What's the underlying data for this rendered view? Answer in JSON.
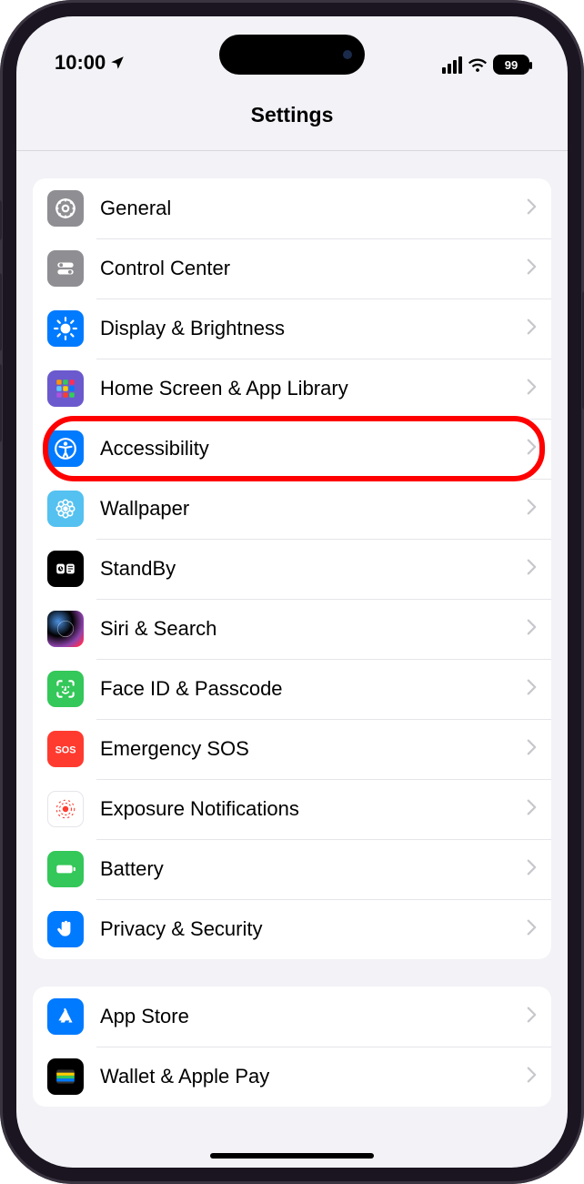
{
  "status": {
    "time": "10:00",
    "battery": "99"
  },
  "nav": {
    "title": "Settings"
  },
  "annotation": {
    "highlightedKey": "accessibility",
    "highlightColor": "#ff0000"
  },
  "groups": [
    {
      "items": [
        {
          "key": "general",
          "label": "General",
          "icon": "gear-icon",
          "color": "c-gray"
        },
        {
          "key": "control-center",
          "label": "Control Center",
          "icon": "switches-icon",
          "color": "c-gray"
        },
        {
          "key": "display-brightness",
          "label": "Display & Brightness",
          "icon": "sun-icon",
          "color": "c-blue"
        },
        {
          "key": "home-screen",
          "label": "Home Screen & App Library",
          "icon": "grid-icon",
          "color": "c-purple"
        },
        {
          "key": "accessibility",
          "label": "Accessibility",
          "icon": "accessibility-icon",
          "color": "c-blue",
          "highlighted": true
        },
        {
          "key": "wallpaper",
          "label": "Wallpaper",
          "icon": "flower-icon",
          "color": "c-lightblue"
        },
        {
          "key": "standby",
          "label": "StandBy",
          "icon": "standby-icon",
          "color": "c-black"
        },
        {
          "key": "siri-search",
          "label": "Siri & Search",
          "icon": "siri-icon",
          "color": "c-siri"
        },
        {
          "key": "faceid-passcode",
          "label": "Face ID & Passcode",
          "icon": "faceid-icon",
          "color": "c-green"
        },
        {
          "key": "emergency-sos",
          "label": "Emergency SOS",
          "icon": "sos-icon",
          "color": "c-red"
        },
        {
          "key": "exposure-notifications",
          "label": "Exposure Notifications",
          "icon": "exposure-icon",
          "color": "c-white"
        },
        {
          "key": "battery",
          "label": "Battery",
          "icon": "battery-icon",
          "color": "c-green"
        },
        {
          "key": "privacy-security",
          "label": "Privacy & Security",
          "icon": "hand-icon",
          "color": "c-blue"
        }
      ]
    },
    {
      "items": [
        {
          "key": "app-store",
          "label": "App Store",
          "icon": "appstore-icon",
          "color": "c-blue"
        },
        {
          "key": "wallet-apple-pay",
          "label": "Wallet & Apple Pay",
          "icon": "wallet-icon",
          "color": "c-black"
        }
      ]
    }
  ]
}
